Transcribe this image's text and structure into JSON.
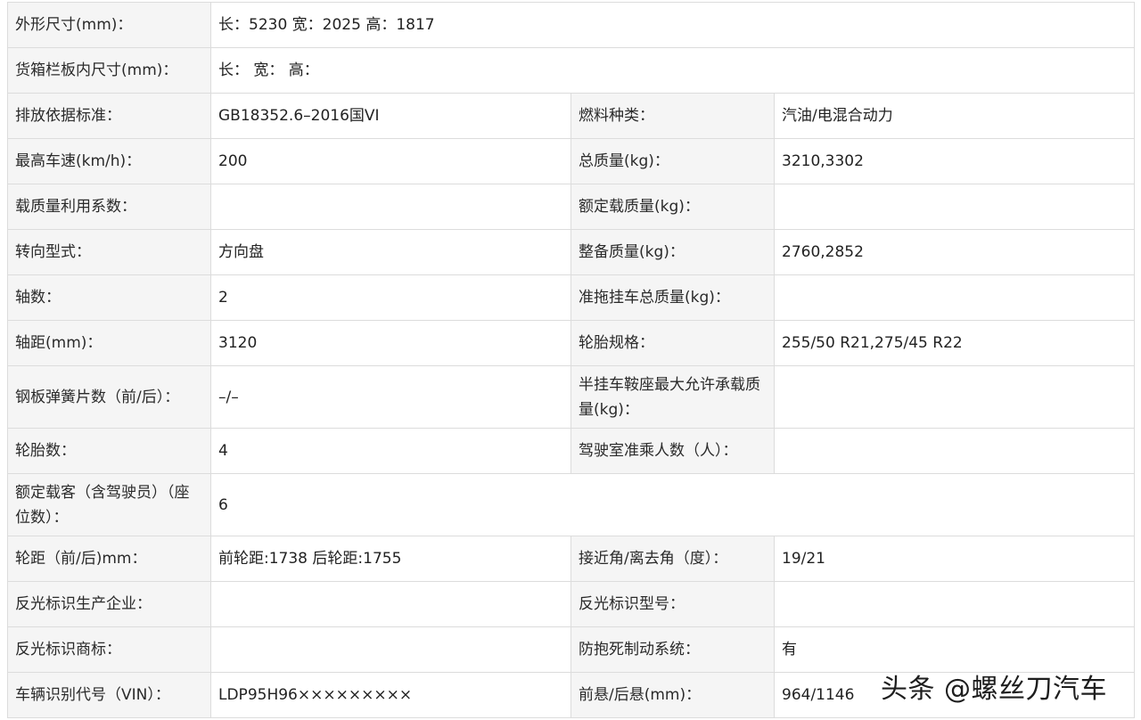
{
  "rows": [
    {
      "type": "wide",
      "label": "外形尺寸(mm)：",
      "value": "长：5230 宽：2025 高：1817"
    },
    {
      "type": "wide",
      "label": "货箱栏板内尺寸(mm)：",
      "value": "长： 宽： 高："
    },
    {
      "type": "pair",
      "label1": "排放依据标准：",
      "value1": "GB18352.6–2016国VI",
      "label2": "燃料种类：",
      "value2": "汽油/电混合动力"
    },
    {
      "type": "pair",
      "label1": "最高车速(km/h)：",
      "value1": "200",
      "label2": "总质量(kg)：",
      "value2": "3210,3302"
    },
    {
      "type": "pair",
      "label1": "载质量利用系数：",
      "value1": "",
      "label2": "额定载质量(kg)：",
      "value2": ""
    },
    {
      "type": "pair",
      "label1": "转向型式：",
      "value1": "方向盘",
      "label2": "整备质量(kg)：",
      "value2": "2760,2852"
    },
    {
      "type": "pair",
      "label1": "轴数：",
      "value1": "2",
      "label2": "准拖挂车总质量(kg)：",
      "value2": ""
    },
    {
      "type": "pair",
      "label1": "轴距(mm)：",
      "value1": "3120",
      "label2": "轮胎规格：",
      "value2": "255/50 R21,275/45 R22"
    },
    {
      "type": "pair",
      "label1": "钢板弹簧片数（前/后）：",
      "value1": "–/–",
      "label2": "半挂车鞍座最大允许承载质量(kg)：",
      "value2": ""
    },
    {
      "type": "pair",
      "label1": "轮胎数：",
      "value1": "4",
      "label2": "驾驶室准乘人数（人）：",
      "value2": ""
    },
    {
      "type": "wide",
      "label": "额定载客（含驾驶员）（座位数）：",
      "value": "6"
    },
    {
      "type": "pair",
      "label1": "轮距（前/后)mm：",
      "value1": "前轮距:1738 后轮距:1755",
      "label2": "接近角/离去角（度）：",
      "value2": "19/21"
    },
    {
      "type": "pair",
      "label1": "反光标识生产企业：",
      "value1": "",
      "label2": "反光标识型号：",
      "value2": ""
    },
    {
      "type": "pair",
      "label1": "反光标识商标：",
      "value1": "",
      "label2": "防抱死制动系统：",
      "value2": "有"
    },
    {
      "type": "pair",
      "label1": "车辆识别代号（VIN）：",
      "value1": "LDP95H96×××××××××",
      "label2": "前悬/后悬(mm)：",
      "value2": "964/1146"
    }
  ],
  "watermark": "头条 @螺丝刀汽车"
}
